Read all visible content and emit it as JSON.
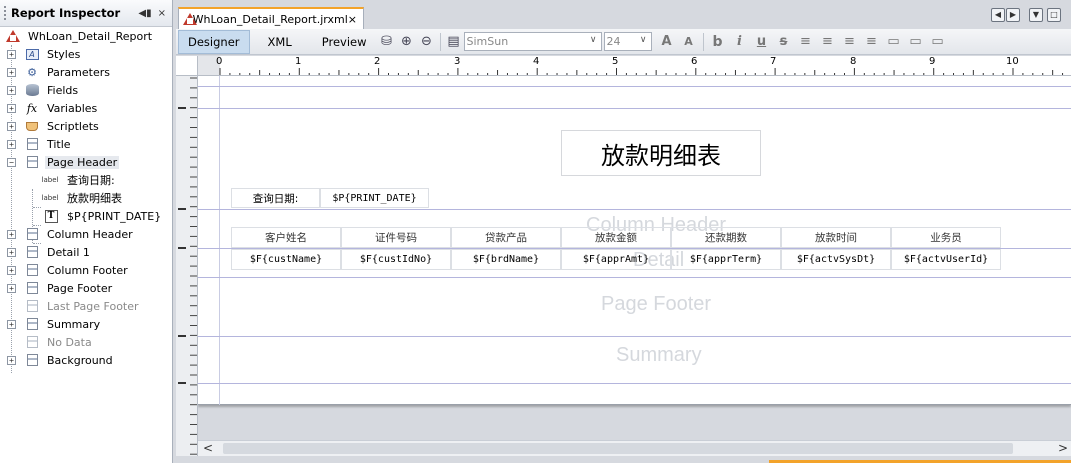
{
  "inspector": {
    "title": "Report Inspector",
    "controls": [
      "◀▮",
      "×"
    ],
    "root": "WhLoan_Detail_Report",
    "items": [
      {
        "label": "Styles",
        "icon": "styles-icon"
      },
      {
        "label": "Parameters",
        "icon": "parameters-icon"
      },
      {
        "label": "Fields",
        "icon": "fields-icon"
      },
      {
        "label": "Variables",
        "icon": "variables-icon"
      },
      {
        "label": "Scriptlets",
        "icon": "scriptlets-icon"
      },
      {
        "label": "Title",
        "icon": "band-icon"
      },
      {
        "label": "Page Header",
        "icon": "band-icon"
      },
      {
        "label": "查询日期:",
        "icon": "label-icon"
      },
      {
        "label": "放款明细表",
        "icon": "label-icon"
      },
      {
        "label": "$P{PRINT_DATE}",
        "icon": "textfield-icon"
      },
      {
        "label": "Column Header",
        "icon": "band-icon"
      },
      {
        "label": "Detail 1",
        "icon": "band-icon"
      },
      {
        "label": "Column Footer",
        "icon": "band-icon"
      },
      {
        "label": "Page Footer",
        "icon": "band-icon"
      },
      {
        "label": "Last Page Footer",
        "icon": "band-icon"
      },
      {
        "label": "Summary",
        "icon": "band-icon"
      },
      {
        "label": "No Data",
        "icon": "band-icon"
      },
      {
        "label": "Background",
        "icon": "band-icon"
      }
    ],
    "label_icon_text": "label",
    "textfield_icon_text": "T"
  },
  "tab": {
    "label": "WhLoan_Detail_Report.jrxml",
    "close": "×"
  },
  "toolbar": {
    "designer": "Designer",
    "xml": "XML",
    "preview": "Preview",
    "font": "SimSun",
    "size": "24"
  },
  "ruler": {
    "numbers": [
      "0",
      "1",
      "2",
      "3",
      "4",
      "5",
      "6",
      "7",
      "8",
      "9",
      "10"
    ]
  },
  "report": {
    "title": "放款明细表",
    "date_label": "查询日期:",
    "date_field": "$P{PRINT_DATE}",
    "band_watermarks": {
      "column_header": "Column Header",
      "detail": "Detail",
      "page_footer": "Page Footer",
      "summary": "Summary"
    },
    "columns": [
      "客户姓名",
      "证件号码",
      "贷款产品",
      "放款金额",
      "还款期数",
      "放款时间",
      "业务员"
    ],
    "fields": [
      "$F{custName}",
      "$F{custIdNo}",
      "$F{brdName}",
      "$F{apprAmt}",
      "$F{apprTerm}",
      "$F{actvSysDt}",
      "$F{actvUserId}"
    ]
  },
  "scroll": {
    "left": "<",
    "right": ">"
  }
}
